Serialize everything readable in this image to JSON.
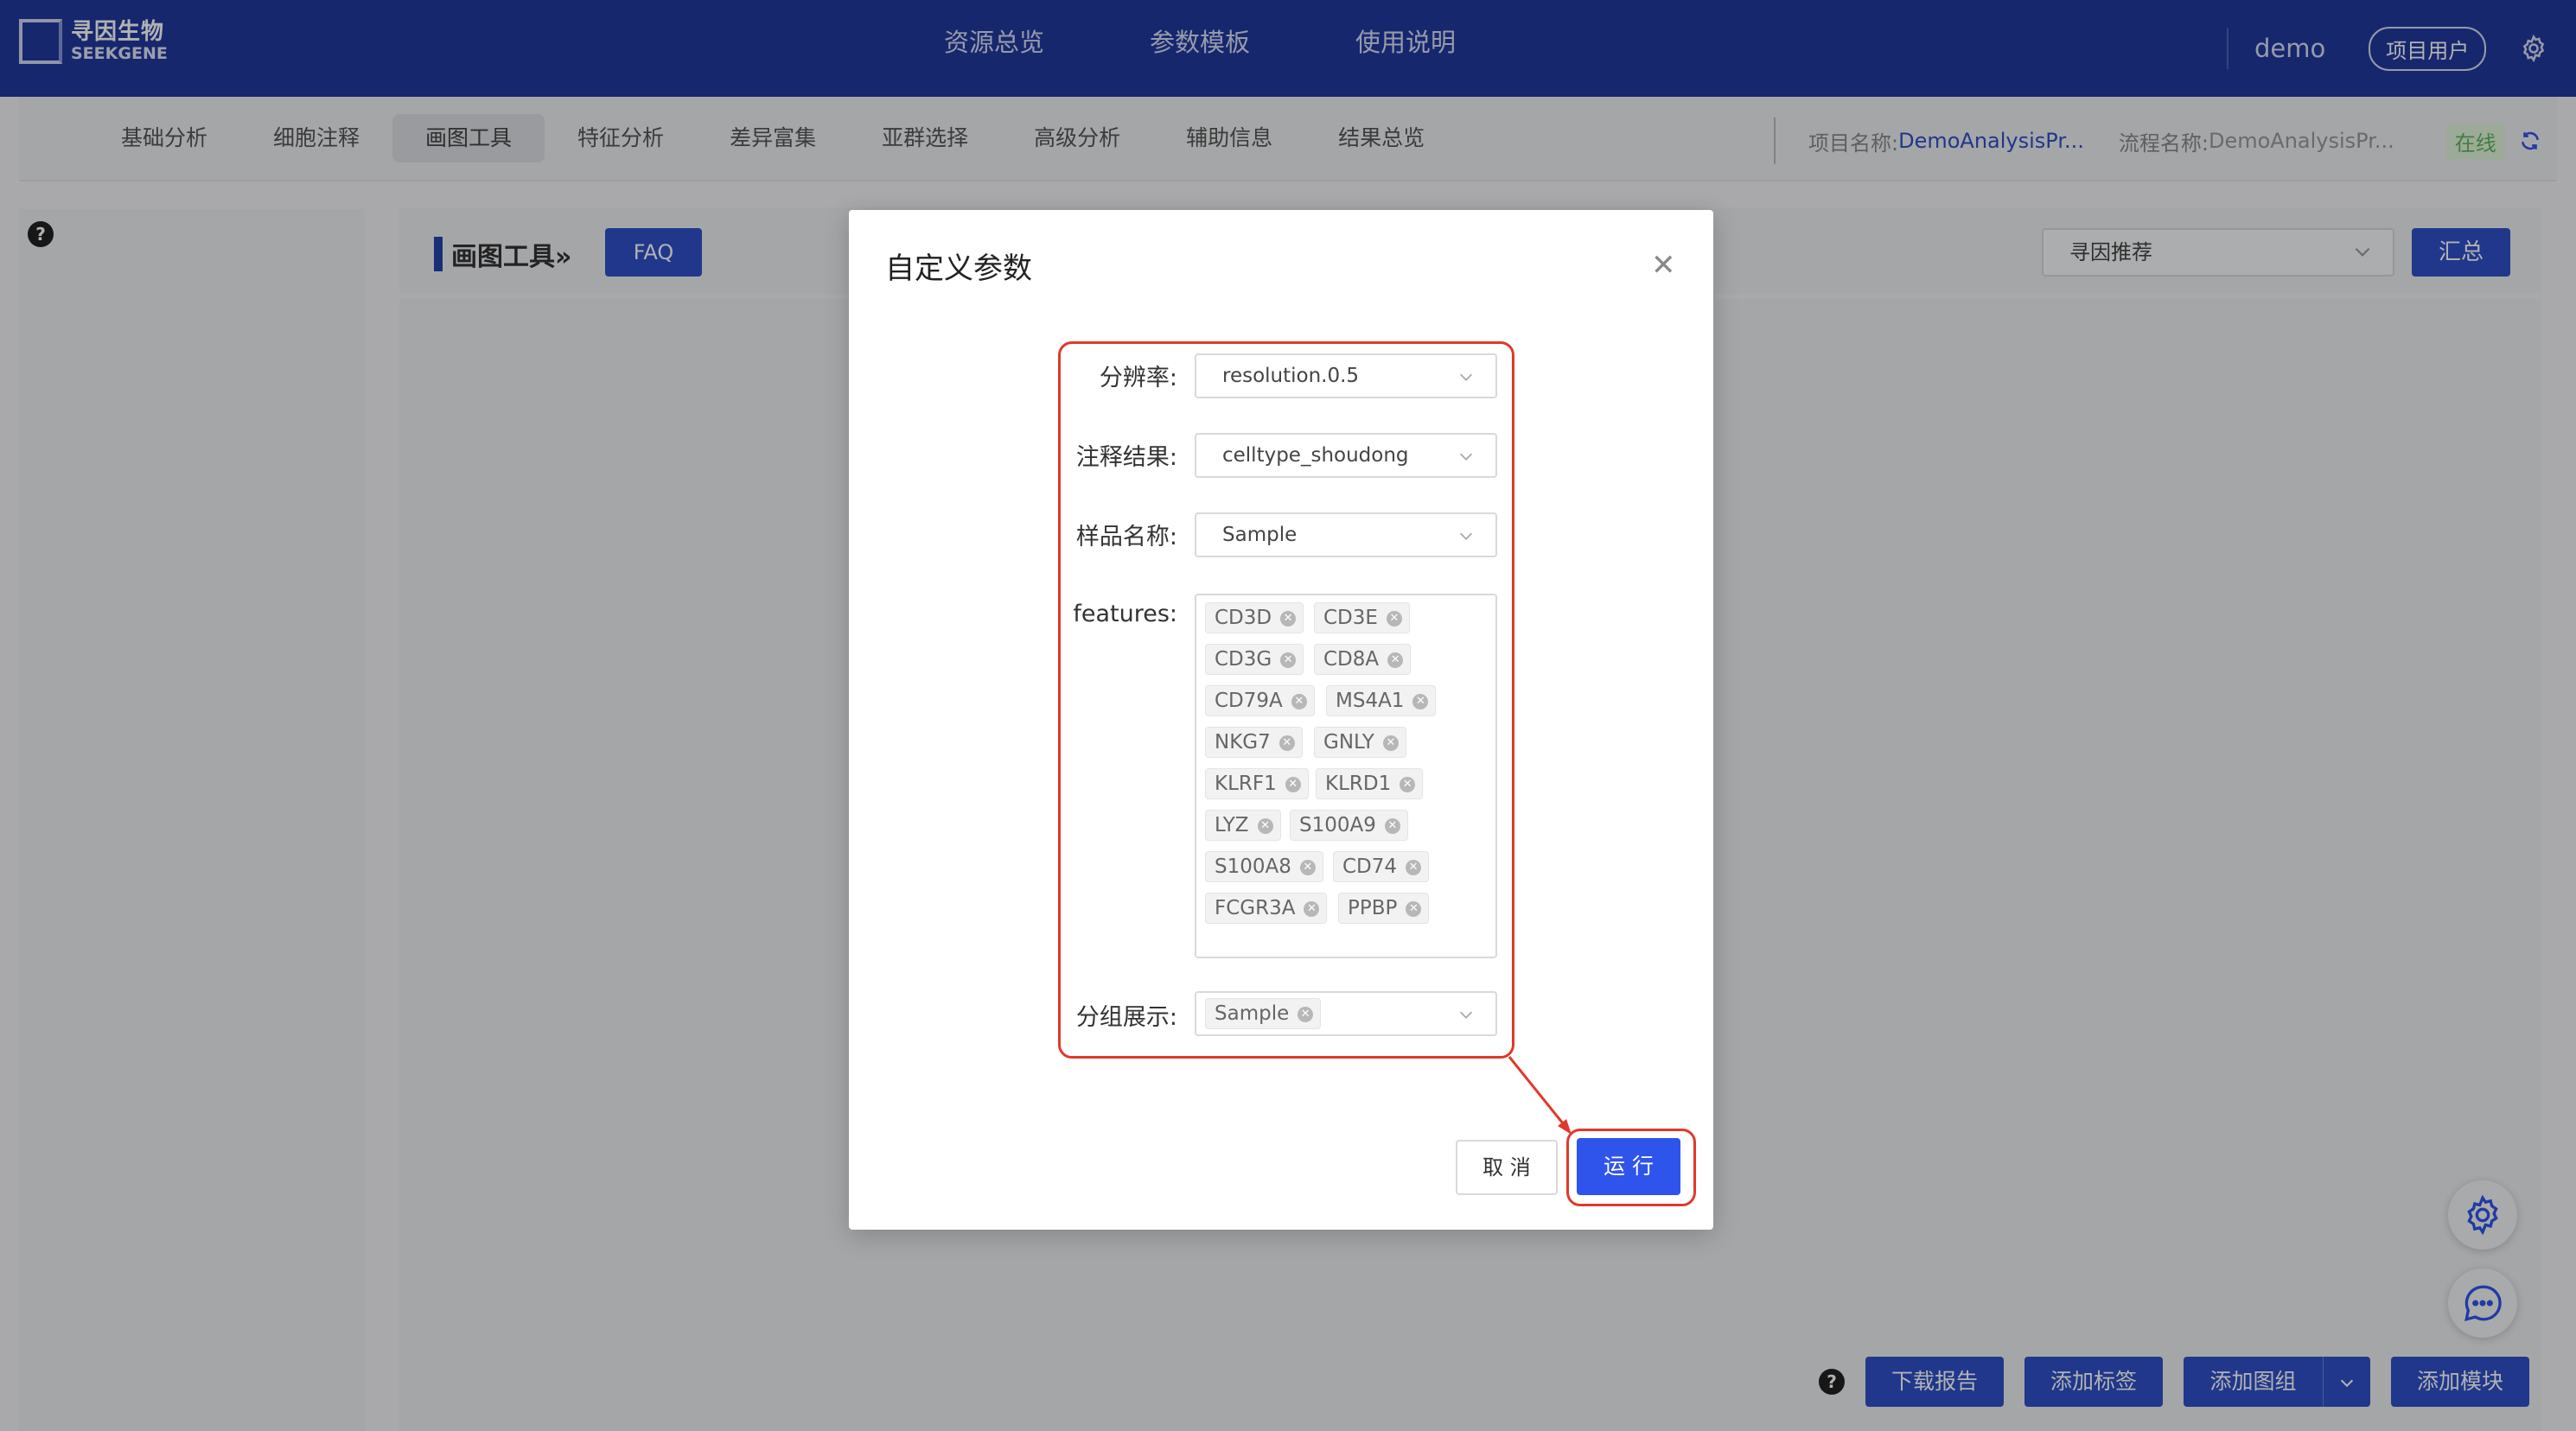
{
  "header": {
    "logo_cn": "寻因生物",
    "logo_en": "SEEKGENE",
    "nav": [
      "资源总览",
      "参数模板",
      "使用说明"
    ],
    "user": "demo",
    "role": "项目用户"
  },
  "tabs": [
    "基础分析",
    "细胞注释",
    "画图工具",
    "特征分析",
    "差异富集",
    "亚群选择",
    "高级分析",
    "辅助信息",
    "结果总览"
  ],
  "active_tab": "画图工具",
  "project": {
    "name_label": "项目名称:",
    "name_value": "DemoAnalysisPr...",
    "flow_label": "流程名称:",
    "flow_value": "DemoAnalysisPr...",
    "status": "在线"
  },
  "main": {
    "title": "画图工具»",
    "faq": "FAQ",
    "recommend": "寻因推荐",
    "summary_button": "汇总"
  },
  "bottom": {
    "download": "下载报告",
    "add_tag": "添加标签",
    "add_group": "添加图组",
    "add_module": "添加模块"
  },
  "modal": {
    "title": "自定义参数",
    "fields": {
      "resolution_label": "分辨率:",
      "resolution_value": "resolution.0.5",
      "annotation_label": "注释结果:",
      "annotation_value": "celltype_shoudong",
      "sample_label": "样品名称:",
      "sample_value": "Sample",
      "features_label": "features:",
      "features": [
        "CD3D",
        "CD3E",
        "CD3G",
        "CD8A",
        "CD79A",
        "MS4A1",
        "NKG7",
        "GNLY",
        "KLRF1",
        "KLRD1",
        "LYZ",
        "S100A9",
        "S100A8",
        "CD74",
        "FCGR3A",
        "PPBP"
      ],
      "group_label": "分组展示:",
      "group_tags": [
        "Sample"
      ]
    },
    "cancel": "取 消",
    "run": "运 行"
  },
  "colors": {
    "header_bg": "#21399e",
    "primary": "#2f4fc7",
    "run": "#2f54eb",
    "highlight": "#e0392b"
  }
}
